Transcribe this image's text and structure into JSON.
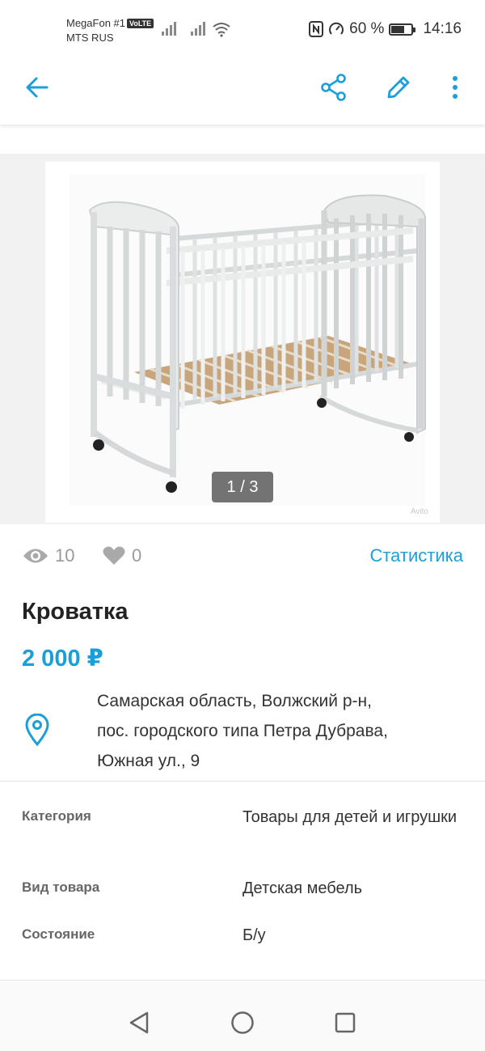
{
  "status_bar": {
    "carrier_1": "MegaFon #1",
    "volte": "VoLTE",
    "carrier_2": "MTS RUS",
    "battery_percent": "60 %",
    "battery_level": 0.6,
    "time": "14:16"
  },
  "toolbar": {
    "back_icon": "arrow-left-icon",
    "share_icon": "share-icon",
    "edit_icon": "pencil-icon",
    "more_icon": "more-vertical-icon",
    "accent_color": "#1c9fd8"
  },
  "gallery": {
    "counter": "1 / 3",
    "watermark": "Avito"
  },
  "stats": {
    "views": "10",
    "favorites": "0",
    "statistics_link": "Статистика"
  },
  "listing": {
    "title": "Кроватка",
    "price": "2 000 ₽",
    "address_line1": "Самарская область, Волжский р-н,",
    "address_line2": "пос. городского типа Петра Дубрава,",
    "address_line3": "Южная ул., 9"
  },
  "params": [
    {
      "key": "Категория",
      "value": "Товары для детей и игрушки"
    },
    {
      "key": "Вид товара",
      "value": "Детская мебель"
    },
    {
      "key": "Состояние",
      "value": "Б/у"
    }
  ],
  "navbar": {
    "back_icon": "triangle-back-icon",
    "home_icon": "circle-home-icon",
    "recents_icon": "square-recents-icon"
  }
}
